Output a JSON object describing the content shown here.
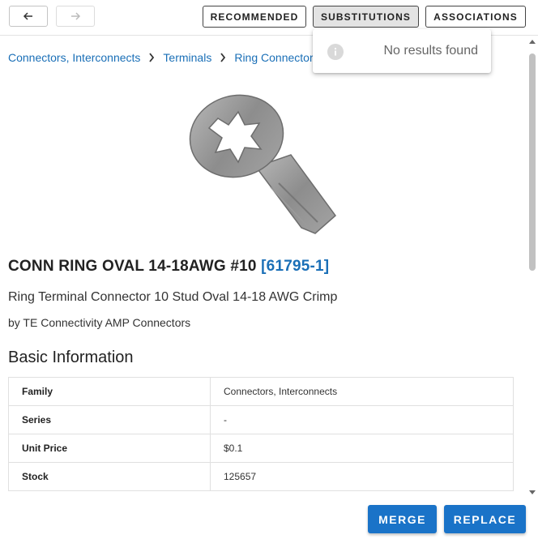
{
  "toolbar": {
    "back_icon": "arrow-left-icon",
    "forward_icon": "arrow-right-icon",
    "tabs": {
      "recommended": "RECOMMENDED",
      "substitutions": "SUBSTITUTIONS",
      "associations": "ASSOCIATIONS"
    },
    "active_tab": "substitutions"
  },
  "breadcrumb": [
    "Connectors, Interconnects",
    "Terminals",
    "Ring Connectors"
  ],
  "popup": {
    "icon": "info-icon",
    "message": "No results found"
  },
  "product": {
    "title": "CONN RING OVAL 14-18AWG #10",
    "part_number": "[61795-1]",
    "description": "Ring Terminal Connector 10 Stud Oval 14-18 AWG Crimp",
    "byline": "by TE Connectivity AMP Connectors"
  },
  "basic_info": {
    "heading": "Basic Information",
    "rows": [
      {
        "key": "Family",
        "value": "Connectors, Interconnects"
      },
      {
        "key": "Series",
        "value": "-"
      },
      {
        "key": "Unit Price",
        "value": "$0.1"
      },
      {
        "key": "Stock",
        "value": "125657"
      }
    ]
  },
  "actions": {
    "merge": "MERGE",
    "replace": "REPLACE"
  },
  "colors": {
    "link": "#1a6fb7",
    "primary_button": "#1a73c8",
    "active_tab_bg": "#e3e3e3"
  }
}
